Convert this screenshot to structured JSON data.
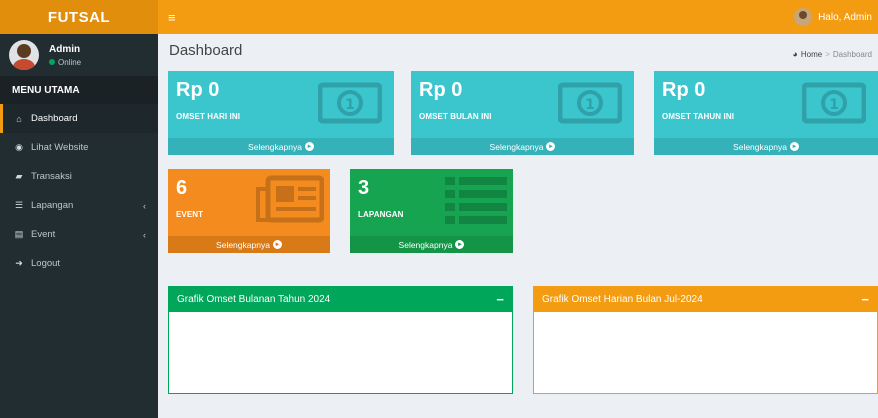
{
  "brand": "FUTSAL",
  "topbar": {
    "menu_icon": "≡",
    "greeting": "Halo, Admin"
  },
  "user": {
    "name": "Admin",
    "status": "Online"
  },
  "sidebar": {
    "header": "MENU UTAMA",
    "items": [
      {
        "label": "Dashboard",
        "icon": "home-icon",
        "glyph": "⌂",
        "active": true
      },
      {
        "label": "Lihat Website",
        "icon": "globe-icon",
        "glyph": "◉"
      },
      {
        "label": "Transaksi",
        "icon": "book-icon",
        "glyph": "▰"
      },
      {
        "label": "Lapangan",
        "icon": "list-icon",
        "glyph": "☰",
        "caret": "‹"
      },
      {
        "label": "Event",
        "icon": "newspaper-icon",
        "glyph": "▤",
        "caret": "‹"
      },
      {
        "label": "Logout",
        "icon": "logout-icon",
        "glyph": "➜"
      }
    ]
  },
  "page": {
    "title": "Dashboard",
    "breadcrumb": {
      "home": "Home",
      "separator": ">",
      "current": "Dashboard"
    }
  },
  "stats": [
    {
      "value": "Rp 0",
      "label": "OMSET HARI INI",
      "more": "Selengkapnya",
      "color": "#3bc6ce",
      "icon": "money-icon"
    },
    {
      "value": "Rp 0",
      "label": "OMSET BULAN INI",
      "more": "Selengkapnya",
      "color": "#3bc6ce",
      "icon": "money-icon"
    },
    {
      "value": "Rp 0",
      "label": "OMSET TAHUN INI",
      "more": "Selengkapnya",
      "color": "#3bc6ce",
      "icon": "money-icon"
    },
    {
      "value": "6",
      "label": "EVENT",
      "more": "Selengkapnya",
      "color": "#f38b1f",
      "icon": "newspaper-icon"
    },
    {
      "value": "3",
      "label": "LAPANGAN",
      "more": "Selengkapnya",
      "color": "#16a450",
      "icon": "list-icon"
    }
  ],
  "panels": [
    {
      "title": "Grafik Omset Bulanan Tahun 2024",
      "color": "#00a65a",
      "collapse": "−"
    },
    {
      "title": "Grafik Omset Harian Bulan Jul-2024",
      "color": "#f39c12",
      "collapse": "−"
    }
  ]
}
